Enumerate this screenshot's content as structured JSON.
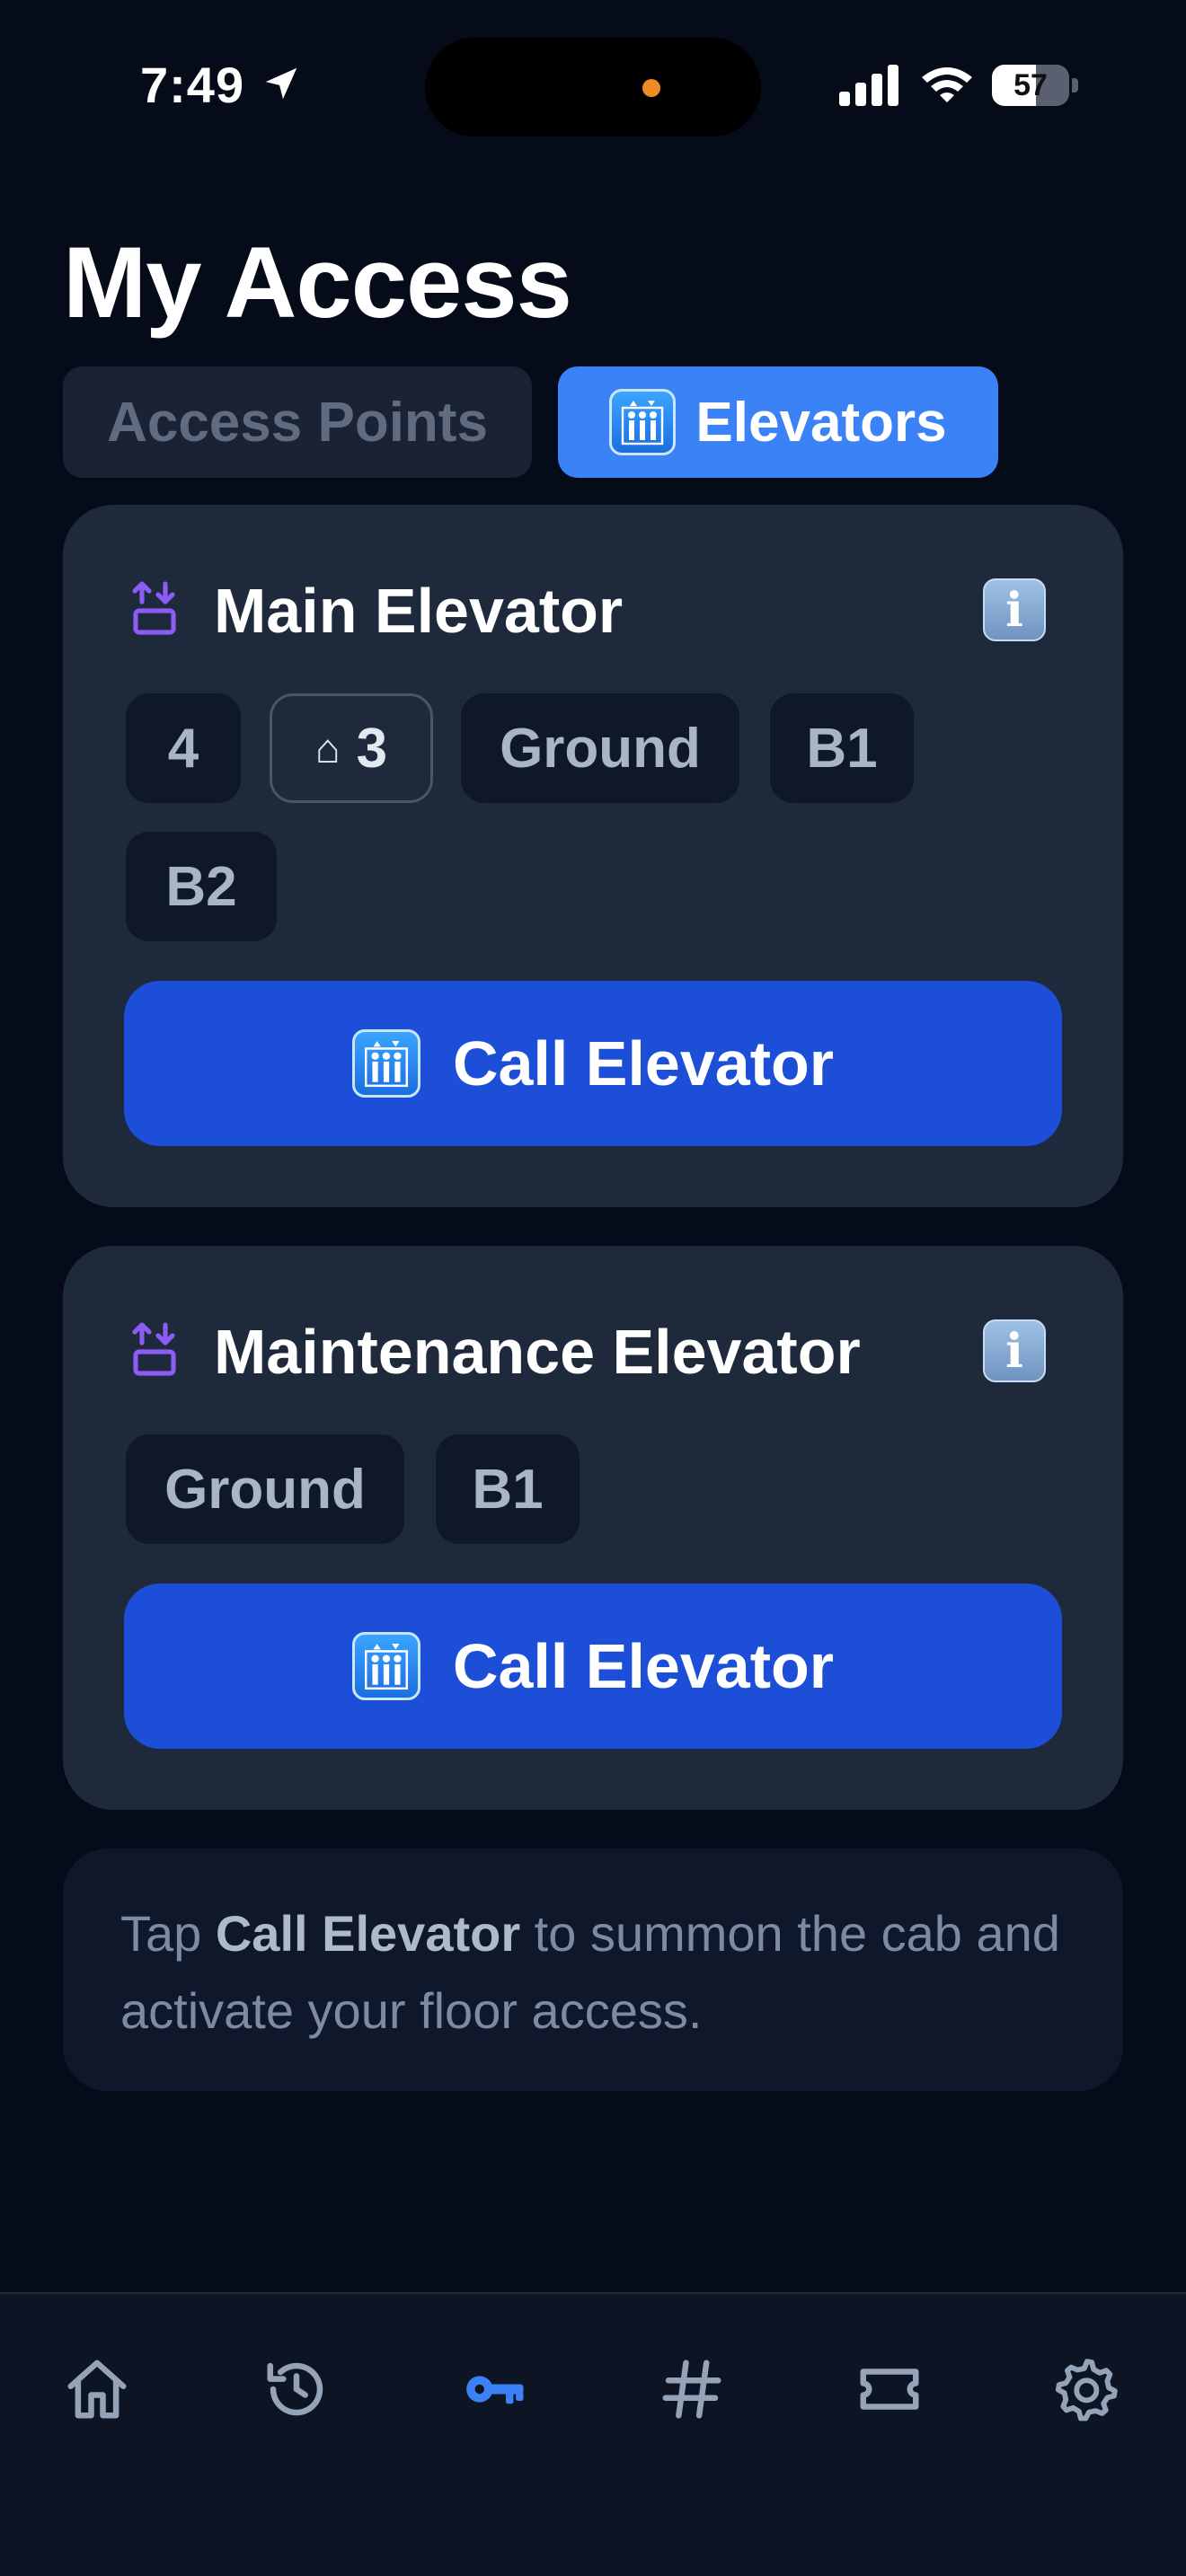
{
  "status_bar": {
    "time": "7:49",
    "battery_level": "57",
    "icons": [
      "location-arrow-icon",
      "signal-icon",
      "wifi-icon",
      "battery-icon"
    ]
  },
  "page": {
    "title": "My Access"
  },
  "tabs": [
    {
      "label": "Access Points",
      "selected": false
    },
    {
      "label": "Elevators",
      "icon": "elevator-icon",
      "selected": true
    }
  ],
  "elevators": [
    {
      "name": "Main Elevator",
      "icon": "up-down-arrows-icon",
      "floors": [
        {
          "label": "4",
          "current": false
        },
        {
          "label": "3",
          "current": true,
          "icon": "home-icon",
          "glyph": "⌂"
        },
        {
          "label": "Ground",
          "current": false
        },
        {
          "label": "B1",
          "current": false
        },
        {
          "label": "B2",
          "current": false
        }
      ],
      "call_label": "Call Elevator",
      "info_glyph": "i"
    },
    {
      "name": "Maintenance Elevator",
      "icon": "up-down-arrows-icon",
      "floors": [
        {
          "label": "Ground",
          "current": false
        },
        {
          "label": "B1",
          "current": false
        }
      ],
      "call_label": "Call Elevator",
      "info_glyph": "i"
    }
  ],
  "hint": {
    "prefix": "Tap ",
    "bold": "Call Elevator",
    "suffix": " to summon the cab and activate your floor access."
  },
  "bottom_nav": [
    {
      "icon": "home-icon",
      "active": false
    },
    {
      "icon": "history-icon",
      "active": false
    },
    {
      "icon": "key-icon",
      "active": true
    },
    {
      "icon": "hash-icon",
      "active": false
    },
    {
      "icon": "ticket-icon",
      "active": false
    },
    {
      "icon": "gear-icon",
      "active": false
    }
  ],
  "colors": {
    "background": "#050b18",
    "card": "#1e293b",
    "accent": "#3b82f6",
    "button": "#1d4ed8",
    "inactive_nav": "#94a3b8",
    "icon_purple": "#8b5cf6"
  }
}
